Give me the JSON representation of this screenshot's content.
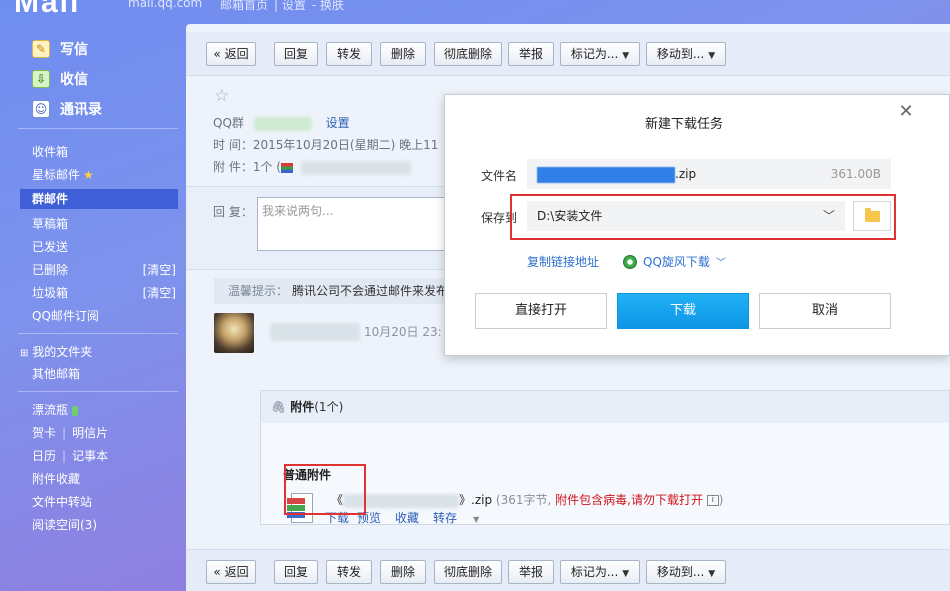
{
  "brand": {
    "logo": "Mail",
    "domain": "mail.qq.com",
    "links": [
      "邮箱首页",
      "设置",
      "换肤"
    ]
  },
  "sidebar": {
    "write": "写信",
    "receive": "收信",
    "contacts": "通讯录",
    "folders": [
      {
        "label": "收件箱"
      },
      {
        "label": "星标邮件"
      },
      {
        "label": "群邮件"
      },
      {
        "label": "草稿箱"
      },
      {
        "label": "已发送"
      },
      {
        "label": "已删除",
        "action": "[清空]"
      },
      {
        "label": "垃圾箱",
        "action": "[清空]"
      },
      {
        "label": "QQ邮件订阅"
      }
    ],
    "my_folders": "我的文件夹",
    "other_mail": "其他邮箱",
    "drift_bottle": "漂流瓶",
    "greeting_card": "贺卡",
    "postcard": "明信片",
    "calendar": "日历",
    "notepad": "记事本",
    "attachment_collection": "附件收藏",
    "file_transfer": "文件中转站",
    "reading_space": "阅读空间(3)"
  },
  "toolbar": {
    "back": "« 返回",
    "reply": "回复",
    "forward": "转发",
    "delete": "删除",
    "delete_permanently": "彻底删除",
    "report": "举报",
    "mark_as": "标记为...",
    "move_to": "移动到..."
  },
  "mail": {
    "group_label": "QQ群",
    "settings_link": "设置",
    "time_label": "时 间：",
    "time_value": "2015年10月20日(星期二) 晚上11",
    "attach_label": "附 件：",
    "attach_value": "1个 (",
    "reply_label": "回 复：",
    "reply_placeholder": "我来说两句...",
    "tip_label": "温馨提示：",
    "tip_text": "腾讯公司不会通过邮件来发布",
    "sender_time": "10月20日 23:"
  },
  "attachment": {
    "header_title": "附件",
    "header_count": "(1个)",
    "section_label": "普通附件",
    "name_prefix": "《",
    "name_suffix": "》.zip",
    "meta_open": "(361字节, ",
    "warning": "附件包含病毒,请勿下载打开",
    "meta_close": ")",
    "actions": {
      "download": "下载",
      "preview": "预览",
      "collect": "收藏",
      "save_to": "转存"
    }
  },
  "dialog": {
    "title": "新建下载任务",
    "file_name_label": "文件名",
    "file_name_suffix": ".zip",
    "file_size": "361.00B",
    "save_to_label": "保存到",
    "save_path": "D:\\安装文件",
    "copy_link": "复制链接地址",
    "qq_download": "QQ旋风下载",
    "open_directly": "直接打开",
    "download": "下载",
    "cancel": "取消"
  },
  "colors": {
    "accent_blue": "#0e95e6",
    "link_blue": "#2c6fcf",
    "highlight_red": "#e03232",
    "warning_red": "#d0151a",
    "active_folder": "#3f5fd8"
  }
}
